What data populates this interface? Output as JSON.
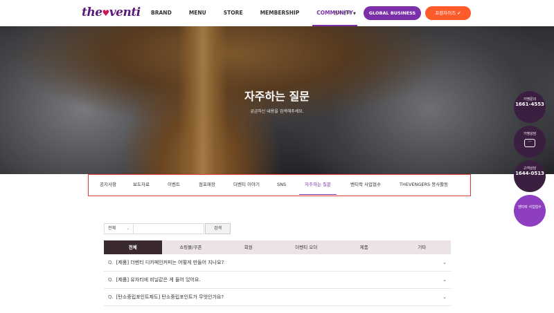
{
  "header": {
    "logo": {
      "the": "the",
      "venti": "venti"
    },
    "nav": [
      "BRAND",
      "MENU",
      "STORE",
      "MEMBERSHIP",
      "COMMUNITY"
    ],
    "active_nav": "COMMUNITY",
    "language": "언어 선택",
    "global_business": "GLOBAL BUSINESS",
    "franchise": "프랜차이즈"
  },
  "hero": {
    "title": "자주하는 질문",
    "subtitle": "궁금하신 내용을 검색해주세요."
  },
  "subtabs": [
    "공지사항",
    "보도자료",
    "이벤트",
    "점포매장",
    "더벤티 이야기",
    "SNS",
    "자주하는 질문",
    "벤티락 사업협수",
    "THEVENGERS 봉사활동"
  ],
  "active_subtab": "자주하는 질문",
  "search": {
    "select_value": "전체",
    "input_placeholder": "",
    "button": "검색"
  },
  "category_tabs": [
    "전체",
    "쇼핑몰/쿠폰",
    "회원",
    "더벤티 오더",
    "제품",
    "기타"
  ],
  "active_category": "전체",
  "faq": [
    {
      "q": "Q.",
      "text": "[제품] 더벤티 디카페인커피는 어떻게 만들어 지나요?"
    },
    {
      "q": "Q.",
      "text": "[제품] 유자티에 비닐같은 게 들어 있어요."
    },
    {
      "q": "Q.",
      "text": "[탄소중립포인트제도] 탄소중립포인트가 무엇인가요?"
    }
  ],
  "side_buttons": [
    {
      "label": "가맹문의",
      "number": "1661-4553"
    },
    {
      "label": "가맹상담"
    },
    {
      "label": "고객상담",
      "number": "1644-0513"
    },
    {
      "label": "벤티락 사업협수"
    }
  ],
  "colors": {
    "brand_purple": "#7b2fa8",
    "franchise_orange": "#ff5a2a",
    "highlight_red": "#e53935",
    "dark_tab": "#3a2a2f"
  }
}
